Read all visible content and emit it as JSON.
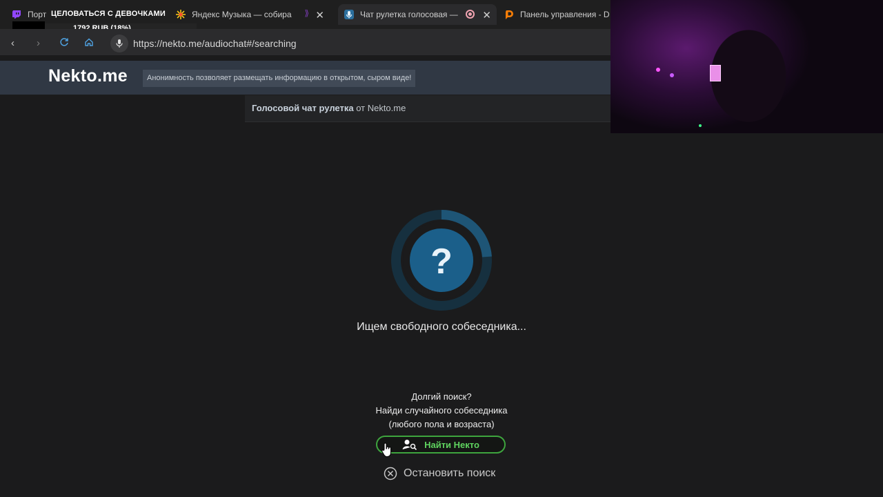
{
  "browser": {
    "tabs": [
      {
        "title": "Порт",
        "icon": "twitch-icon"
      },
      {
        "title": "Яндекс Музыка — собира",
        "icon": "yandex-music-icon"
      },
      {
        "title": "Чат рулетка голосовая —",
        "icon": "microphone-icon",
        "active": true
      },
      {
        "title": "Панель управления - D",
        "icon": "donationalerts-icon"
      }
    ],
    "url": "https://nekto.me/audiochat#/searching"
  },
  "stream_overlay": {
    "title": "ЦЕЛОВАТЬСЯ С ДЕВОЧКАМИ",
    "donation_goal": "1792 RUB (18%)"
  },
  "site": {
    "logo": "Nekto.me",
    "slogan": "Анонимность позволяет размещать информацию в открытом, сыром виде!",
    "subtitle_bold": "Голосовой чат рулетка",
    "subtitle_rest": " от Nekto.me"
  },
  "search": {
    "spinner_symbol": "?",
    "status": "Ищем свободного собеседника...",
    "long_search_line1": "Долгий поиск?",
    "long_search_line2": "Найди случайного собеседника",
    "long_search_line3": "(любого пола и возраста)",
    "find_button": "Найти Некто",
    "stop_button": "Остановить поиск"
  },
  "colors": {
    "background": "#1b1b1c",
    "header": "#303844",
    "accent_blue": "#1b5f8a",
    "button_green": "#3ea53e"
  }
}
